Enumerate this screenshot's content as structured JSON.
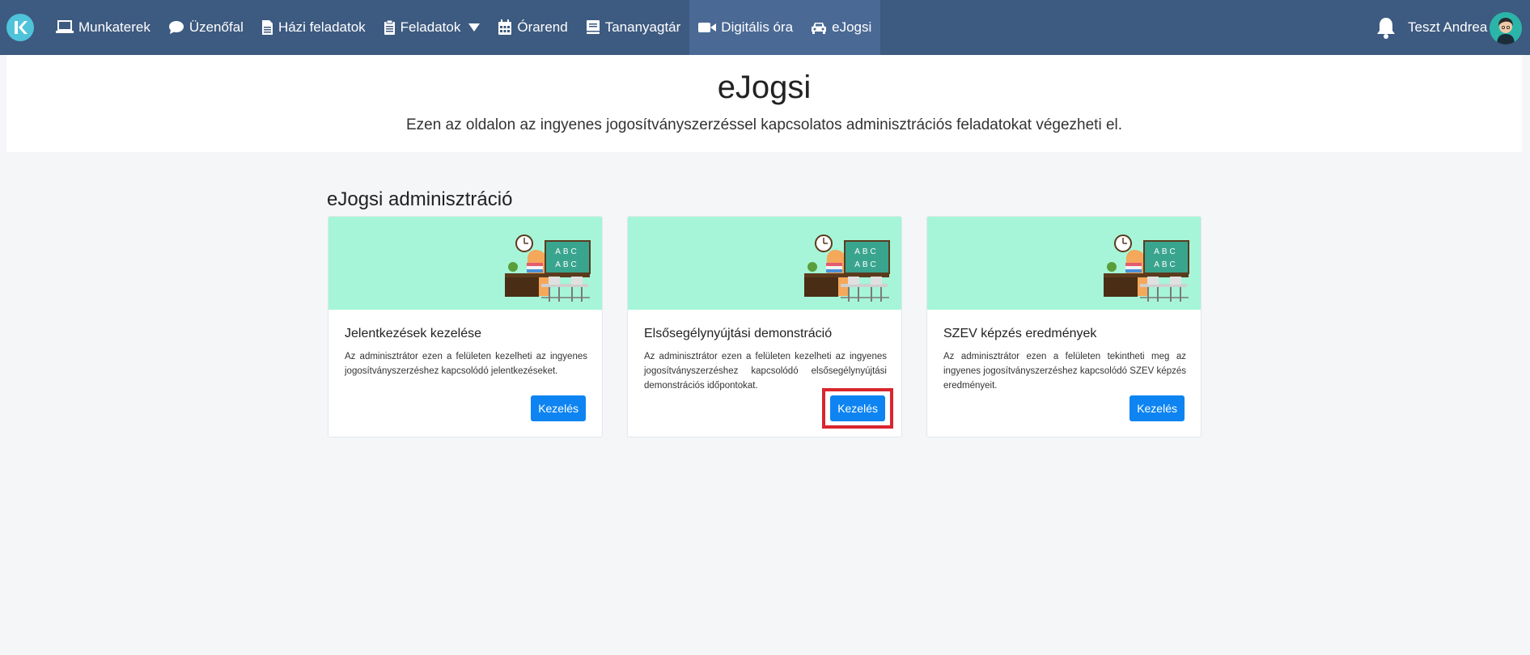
{
  "nav": {
    "items": [
      {
        "label": "Munkaterek",
        "icon": "laptop-icon",
        "active": false
      },
      {
        "label": "Üzenőfal",
        "icon": "chat-bubble-icon",
        "active": false
      },
      {
        "label": "Házi feladatok",
        "icon": "document-icon",
        "active": false
      },
      {
        "label": "Feladatok",
        "icon": "clipboard-icon",
        "active": false,
        "dropdown": true
      },
      {
        "label": "Órarend",
        "icon": "calendar-icon",
        "active": false
      },
      {
        "label": "Tananyagtár",
        "icon": "book-icon",
        "active": false
      },
      {
        "label": "Digitális óra",
        "icon": "video-camera-icon",
        "active": true
      },
      {
        "label": "eJogsi",
        "icon": "car-icon",
        "active": false
      }
    ],
    "user_name": "Teszt Andrea"
  },
  "header": {
    "title": "eJogsi",
    "subtitle": "Ezen az oldalon az ingyenes jogosítványszerzéssel kapcsolatos adminisztrációs feladatokat végezheti el."
  },
  "section": {
    "title": "eJogsi adminisztráció"
  },
  "cards": [
    {
      "title": "Jelentkezések kezelése",
      "text": "Az adminisztrátor ezen a felületen kezelheti az ingyenes jogosítványszerzéshez kapcsolódó jelentkezéseket.",
      "button": "Kezelés"
    },
    {
      "title": "Elsősegélynyújtási demonstráció",
      "text": "Az adminisztrátor ezen a felületen kezelheti az ingyenes jogosítványszerzéshez kapcsolódó elsősegélynyújtási demonstrációs időpontokat.",
      "button": "Kezelés"
    },
    {
      "title": "SZEV képzés eredmények",
      "text": "Az adminisztrátor ezen a felületen tekintheti meg az ingyenes jogosítványszerzéshez kapcsolódó SZEV képzés eredményeit.",
      "button": "Kezelés"
    }
  ],
  "illustration": {
    "board_text": [
      "ABC",
      "ABC"
    ]
  },
  "colors": {
    "navbar": "#3d5a80",
    "navbar_active": "#4a6994",
    "card_banner": "#a6f5d8",
    "button": "#0d84f2",
    "highlight": "#d9262e"
  }
}
